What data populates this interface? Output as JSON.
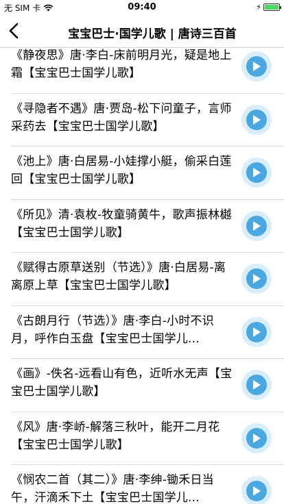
{
  "status": {
    "carrier": "无 SIM 卡",
    "time": "09:40"
  },
  "nav": {
    "title": "宝宝巴士·国学儿歌 | 唐诗三百首"
  },
  "items": [
    {
      "title": "《静夜思》唐·李白-床前明月光，疑是地上霜【宝宝巴士国学儿歌】"
    },
    {
      "title": "《寻隐者不遇》唐·贾岛-松下问童子，言师采药去【宝宝巴士国学儿歌】"
    },
    {
      "title": "《池上》唐·白居易-小娃撑小艇，偷采白莲回【宝宝巴士国学儿歌】"
    },
    {
      "title": "《所见》清·袁枚-牧童骑黄牛，歌声振林樾【宝宝巴士国学儿歌】"
    },
    {
      "title": "《赋得古原草送别（节选）》唐·白居易-离离原上草【宝宝巴士国学儿歌】"
    },
    {
      "title": "《古朗月行（节选）》唐·李白-小时不识月，呼作白玉盘【宝宝巴士国学儿..."
    },
    {
      "title": "《画》-佚名-远看山有色，近听水无声【宝宝巴士国学儿歌】"
    },
    {
      "title": "《风》唐·李峤-解落三秋叶，能开二月花【宝宝巴士国学儿歌】"
    },
    {
      "title": "《悯农二首（其二）》唐·李绅-锄禾日当午，汗滴禾下土【宝宝巴士国学儿..."
    }
  ],
  "colors": {
    "play_outer": "#d9eefb",
    "play_inner": "#4aa7df",
    "battery": "#4cd964"
  }
}
